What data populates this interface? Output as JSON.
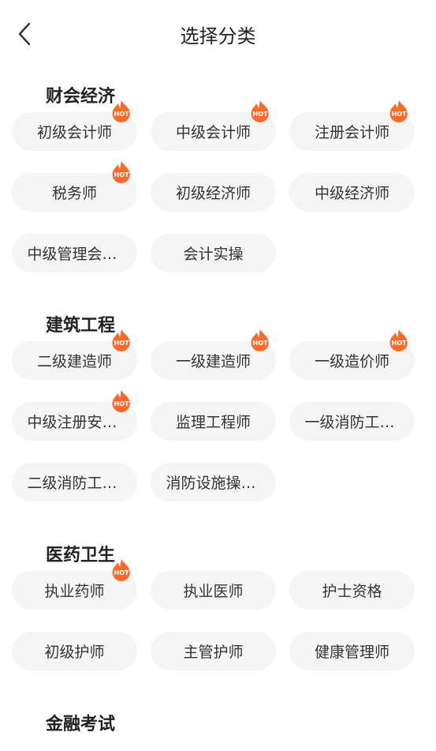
{
  "header": {
    "title": "选择分类"
  },
  "colors": {
    "accent": "#ff6a2b",
    "chip_bg": "#f5f5f5",
    "text": "#333333"
  },
  "hot_badge_text": "HOT",
  "sections": [
    {
      "title": "财会经济",
      "items": [
        {
          "label": "初级会计师",
          "hot": true
        },
        {
          "label": "中级会计师",
          "hot": true
        },
        {
          "label": "注册会计师",
          "hot": true
        },
        {
          "label": "税务师",
          "hot": true
        },
        {
          "label": "初级经济师",
          "hot": false
        },
        {
          "label": "中级经济师",
          "hot": false
        },
        {
          "label": "中级管理会计师",
          "hot": false
        },
        {
          "label": "会计实操",
          "hot": false
        }
      ]
    },
    {
      "title": "建筑工程",
      "items": [
        {
          "label": "二级建造师",
          "hot": true
        },
        {
          "label": "一级建造师",
          "hot": true
        },
        {
          "label": "一级造价师",
          "hot": true
        },
        {
          "label": "中级注册安全工程师",
          "hot": true
        },
        {
          "label": "监理工程师",
          "hot": false
        },
        {
          "label": "一级消防工程师",
          "hot": false
        },
        {
          "label": "二级消防工程师",
          "hot": false
        },
        {
          "label": "消防设施操作员",
          "hot": false
        }
      ]
    },
    {
      "title": "医药卫生",
      "items": [
        {
          "label": "执业药师",
          "hot": true
        },
        {
          "label": "执业医师",
          "hot": false
        },
        {
          "label": "护士资格",
          "hot": false
        },
        {
          "label": "初级护师",
          "hot": false
        },
        {
          "label": "主管护师",
          "hot": false
        },
        {
          "label": "健康管理师",
          "hot": false
        }
      ]
    },
    {
      "title": "金融考试",
      "items": []
    }
  ]
}
